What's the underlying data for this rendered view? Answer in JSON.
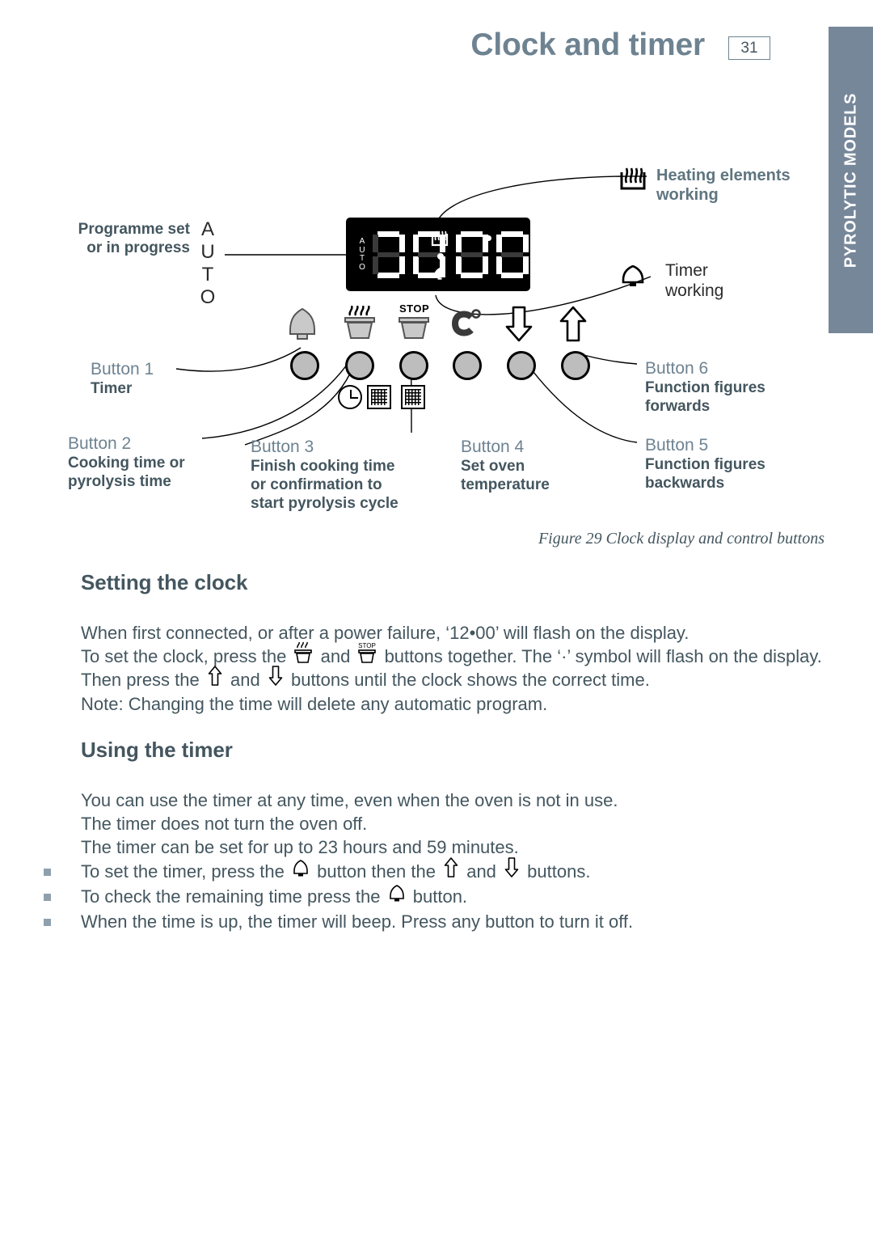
{
  "header": {
    "title": "Clock and timer",
    "page_number": "31"
  },
  "side_tab": {
    "label": "PYROLYTIC MODELS"
  },
  "figure": {
    "caption": "Figure 29 Clock display and control buttons",
    "display": {
      "auto_indicator": "AUTO",
      "auto_stack": "A\nU\nT\nO",
      "digits": "88:88",
      "heat_indicator_icon": "heating-element-icon",
      "timer_indicator_icon": "bell-icon"
    },
    "callouts": {
      "programme_set": "Programme set\nor in progress",
      "heating_elements": "Heating elements\nworking",
      "timer_working": "Timer\nworking",
      "button1_title": "Button 1",
      "button1_sub": "Timer",
      "button2_title": "Button 2",
      "button2_sub": "Cooking time or\npyrolysis time",
      "button3_title": "Button 3",
      "button3_sub": "Finish cooking time\nor confirmation to\nstart pyrolysis cycle",
      "button4_title": "Button 4",
      "button4_sub": "Set oven\ntemperature",
      "button5_title": "Button 5",
      "button5_sub": "Function figures\nbackwards",
      "button6_title": "Button 6",
      "button6_sub": "Function figures\nforwards"
    },
    "button_icons": [
      "bell-icon",
      "pot-with-steam-icon",
      "pot-stop-icon",
      "celsius-degree-icon",
      "arrow-down-icon",
      "arrow-up-icon"
    ],
    "stop_label": "STOP"
  },
  "sections": [
    {
      "title": "Setting the clock",
      "lines": [
        "When first connected, or after a power failure, ‘12•00’ will flash on the display.",
        "To set the clock, press the [pot] and [stop] buttons together. The ‘·’ symbol will flash on the display.",
        "Then press the [up] and [down] buttons until the clock shows the correct time.",
        "Note: Changing the time will delete any automatic program."
      ],
      "line_parts": {
        "l1": "When first connected, or after a power failure, ‘12•00’ will flash on the display.",
        "l2a": "To set the clock, press the",
        "l2b": "and",
        "l2c": "buttons together. The ‘·’ symbol will flash on the display.",
        "l3a": "Then press the",
        "l3b": "and",
        "l3c": "buttons until the clock shows the correct time.",
        "l4": "Note: Changing the time will delete any automatic program."
      }
    },
    {
      "title": "Using the timer",
      "line_parts": {
        "l1": "You can use the timer at any time, even when the oven is not in use.",
        "l2": "The timer does not turn the oven off.",
        "l3": "The timer can be set for up to 23 hours and 59 minutes.",
        "b1a": "To set the timer, press the",
        "b1b": "button then the",
        "b1c": "and",
        "b1d": "buttons.",
        "b2a": "To check the remaining time press the",
        "b2b": "button.",
        "b3": "When the time is up, the timer will beep.  Press any button to turn it off."
      }
    }
  ],
  "colors": {
    "heading": "#6e8391",
    "body_text": "#44565f",
    "side_tab_bg": "#77879a",
    "lcd_bg": "#000000",
    "button_fill": "#bdbdbd",
    "bullet": "#8fa0ad"
  }
}
